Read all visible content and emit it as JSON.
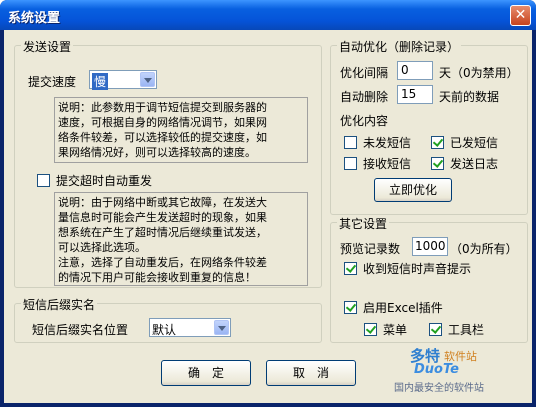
{
  "window": {
    "title": "系统设置",
    "close_glyph": "✕"
  },
  "send": {
    "group_label": "发送设置",
    "speed_label": "提交速度",
    "speed_value": "慢",
    "note1": "说明：此参数用于调节短信提交到服务器的\n速度，可根据自身的网络情况调节，如果网\n络条件较差，可以选择较低的提交速度，如\n果网络情况好，则可以选择较高的速度。",
    "timeout_label": "提交超时自动重发",
    "note2": "说明：由于网络中断或其它故障，在发送大\n量信息时可能会产生发送超时的现象，如果\n想系统在产生了超时情况后继续重试发送，\n可以选择此选项。\n注意，选择了自动重发后，在网络条件较差\n的情况下用户可能会接收到重复的信息！"
  },
  "suffix": {
    "group_label": "短信后缀实名",
    "position_label": "短信后缀实名位置",
    "position_value": "默认"
  },
  "auto": {
    "group_label": "自动优化（删除记录）",
    "interval_label": "优化间隔",
    "interval_value": "0",
    "interval_unit": "天（0为禁用）",
    "delete_label": "自动删除",
    "delete_value": "15",
    "delete_unit": "天前的数据",
    "content_label": "优化内容",
    "unsent": "未发短信",
    "sent": "已发短信",
    "received": "接收短信",
    "send_log": "发送日志",
    "optimize_button": "立即优化"
  },
  "other": {
    "group_label": "其它设置",
    "preview_label": "预览记录数",
    "preview_value": "1000",
    "preview_unit": "（0为所有）",
    "sound_label": "收到短信时声音提示",
    "excel_label": "启用Excel插件",
    "menu_label": "菜单",
    "toolbar_label": "工具栏"
  },
  "buttons": {
    "ok": "确　定",
    "cancel": "取　消"
  },
  "watermark": {
    "brand": "多特",
    "brand_sub": "软件站",
    "site": "DuoTe",
    "slogan": "国内最安全的软件站"
  }
}
